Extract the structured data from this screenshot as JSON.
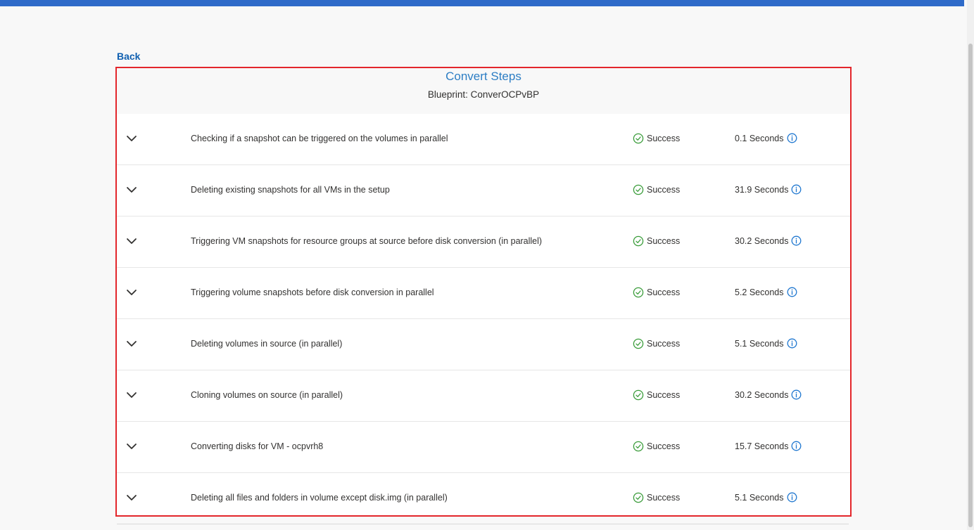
{
  "back_label": "Back",
  "panel": {
    "title": "Convert Steps",
    "subtitle": "Blueprint: ConverOCPvBP"
  },
  "colors": {
    "topbar": "#2f6bc9",
    "link": "#0f5fb0",
    "title": "#2d7ec4",
    "success": "#3a9c3a",
    "info": "#1f77d0",
    "highlight_border": "#e3262b"
  },
  "icons": {
    "expand": "chevron-down-icon",
    "status": "check-circle-icon",
    "info": "info-icon"
  },
  "steps": [
    {
      "name": "Checking if a snapshot can be triggered on the volumes in parallel",
      "status": "Success",
      "duration": "0.1 Seconds"
    },
    {
      "name": "Deleting existing snapshots for all VMs in the setup",
      "status": "Success",
      "duration": "31.9 Seconds"
    },
    {
      "name": "Triggering VM snapshots for resource groups at source before disk conversion (in parallel)",
      "status": "Success",
      "duration": "30.2 Seconds"
    },
    {
      "name": "Triggering volume snapshots before disk conversion in parallel",
      "status": "Success",
      "duration": "5.2 Seconds"
    },
    {
      "name": "Deleting volumes in source (in parallel)",
      "status": "Success",
      "duration": "5.1 Seconds"
    },
    {
      "name": "Cloning volumes on source (in parallel)",
      "status": "Success",
      "duration": "30.2 Seconds"
    },
    {
      "name": "Converting disks for VM - ocpvrh8",
      "status": "Success",
      "duration": "15.7 Seconds"
    },
    {
      "name": "Deleting all files and folders in volume except disk.img (in parallel)",
      "status": "Success",
      "duration": "5.1 Seconds"
    }
  ]
}
